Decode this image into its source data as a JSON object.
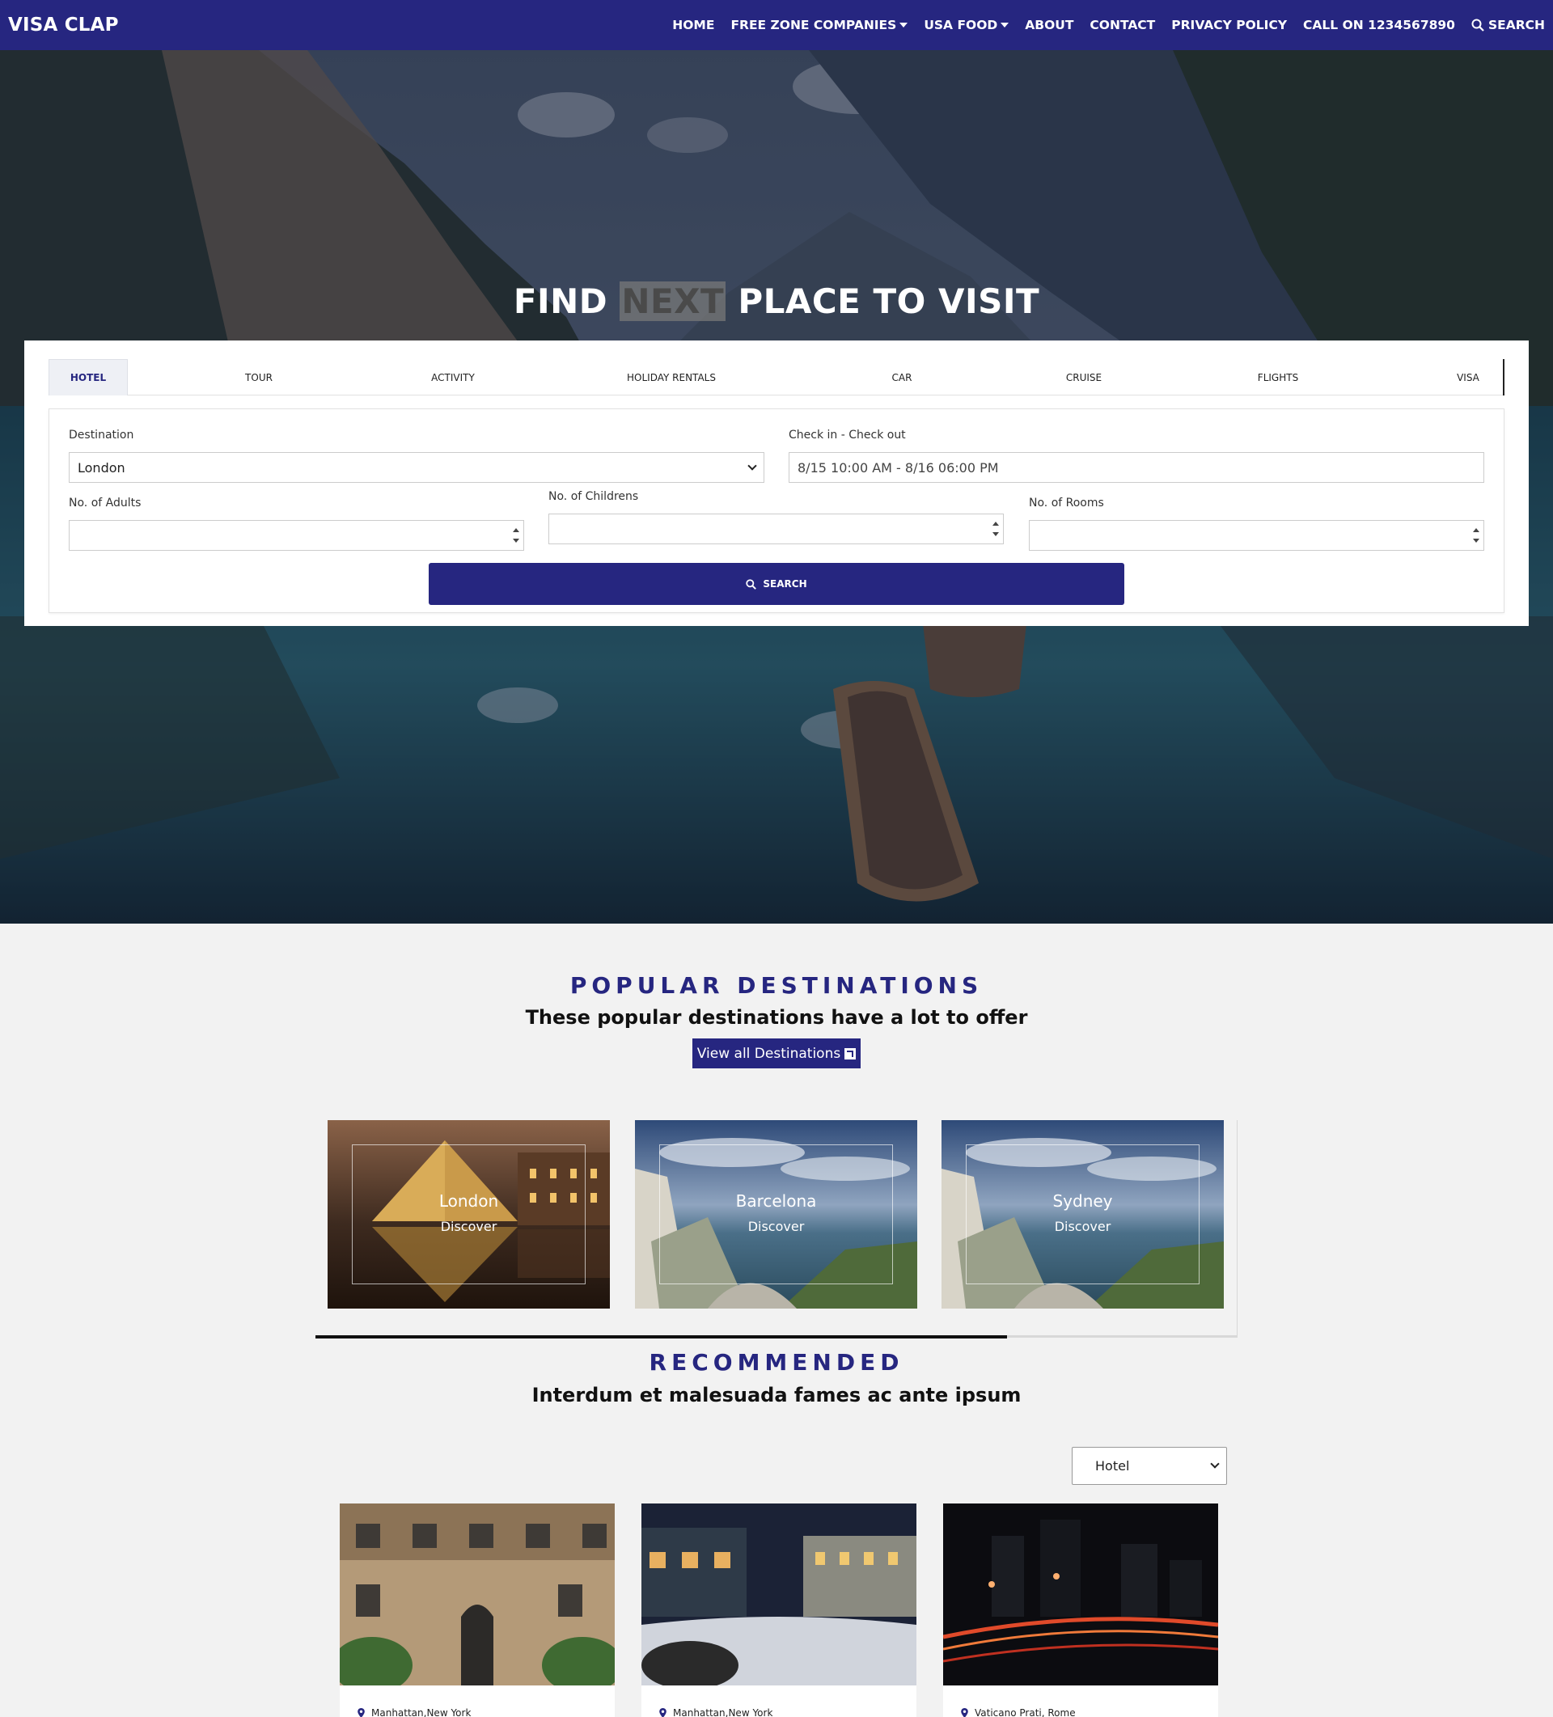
{
  "nav": {
    "brand": "VISA CLAP",
    "items": [
      "HOME",
      "FREE ZONE COMPANIES",
      "USA FOOD",
      "ABOUT",
      "CONTACT",
      "PRIVACY POLICY",
      "CALL ON 1234567890"
    ],
    "search": "SEARCH"
  },
  "hero": {
    "title_part1": "FIND",
    "title_highlight": "NEXT",
    "title_part2": "PLACE TO VISIT"
  },
  "search_panel": {
    "tabs": [
      "HOTEL",
      "TOUR",
      "ACTIVITY",
      "HOLIDAY RENTALS",
      "CAR",
      "CRUISE",
      "FLIGHTS",
      "VISA"
    ],
    "active_tab": "HOTEL",
    "destination_label": "Destination",
    "destination_value": "London",
    "checkin_label": "Check in - Check out",
    "checkin_value": "8/15 10:00 AM - 8/16 06:00 PM",
    "adults_label": "No. of Adults",
    "children_label": "No. of Childrens",
    "rooms_label": "No. of Rooms",
    "search_button": "SEARCH"
  },
  "popular": {
    "title": "POPULAR DESTINATIONS",
    "subtitle": "These popular destinations have a lot to offer",
    "view_all": "View all Destinations",
    "destinations": [
      {
        "name": "London",
        "action": "Discover"
      },
      {
        "name": "Barcelona",
        "action": "Discover"
      },
      {
        "name": "Sydney",
        "action": "Discover"
      }
    ],
    "carousel_progress": 0.75
  },
  "recommended": {
    "title": "RECOMMENDED",
    "subtitle": "Interdum et malesuada fames ac ante ipsum",
    "filter_value": "Hotel",
    "cards": [
      {
        "location": "Manhattan,New York"
      },
      {
        "location": "Manhattan,New York"
      },
      {
        "location": "Vaticano Prati, Rome"
      }
    ]
  },
  "colors": {
    "brand": "#262680",
    "background": "#f2f2f2"
  },
  "icons": [
    "search-icon",
    "caret-down-icon",
    "map-pin-icon",
    "external-link-icon",
    "spinner-arrows-icon"
  ]
}
